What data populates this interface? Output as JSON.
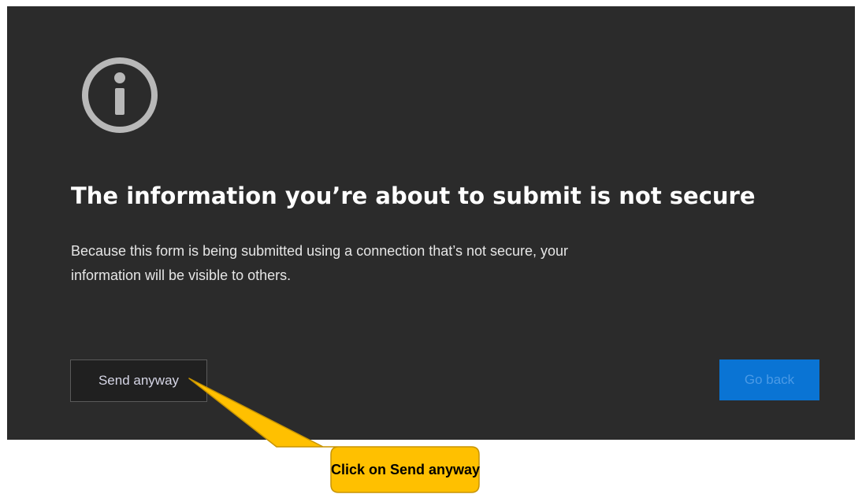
{
  "dialog": {
    "icon": "info-circle-icon",
    "title": "The information you’re about to submit is not secure",
    "body": "Because this form is being submitted using a connection that’s not secure, your information will be visible to others.",
    "send_anyway_label": "Send anyway",
    "go_back_label": "Go back"
  },
  "callout": {
    "text": "Click on Send anyway"
  },
  "colors": {
    "dialog_background": "#2b2b2b",
    "icon": "#b8b8b8",
    "primary_button": "#0a74d4",
    "callout_fill": "#ffc000",
    "callout_border": "#c89400"
  }
}
